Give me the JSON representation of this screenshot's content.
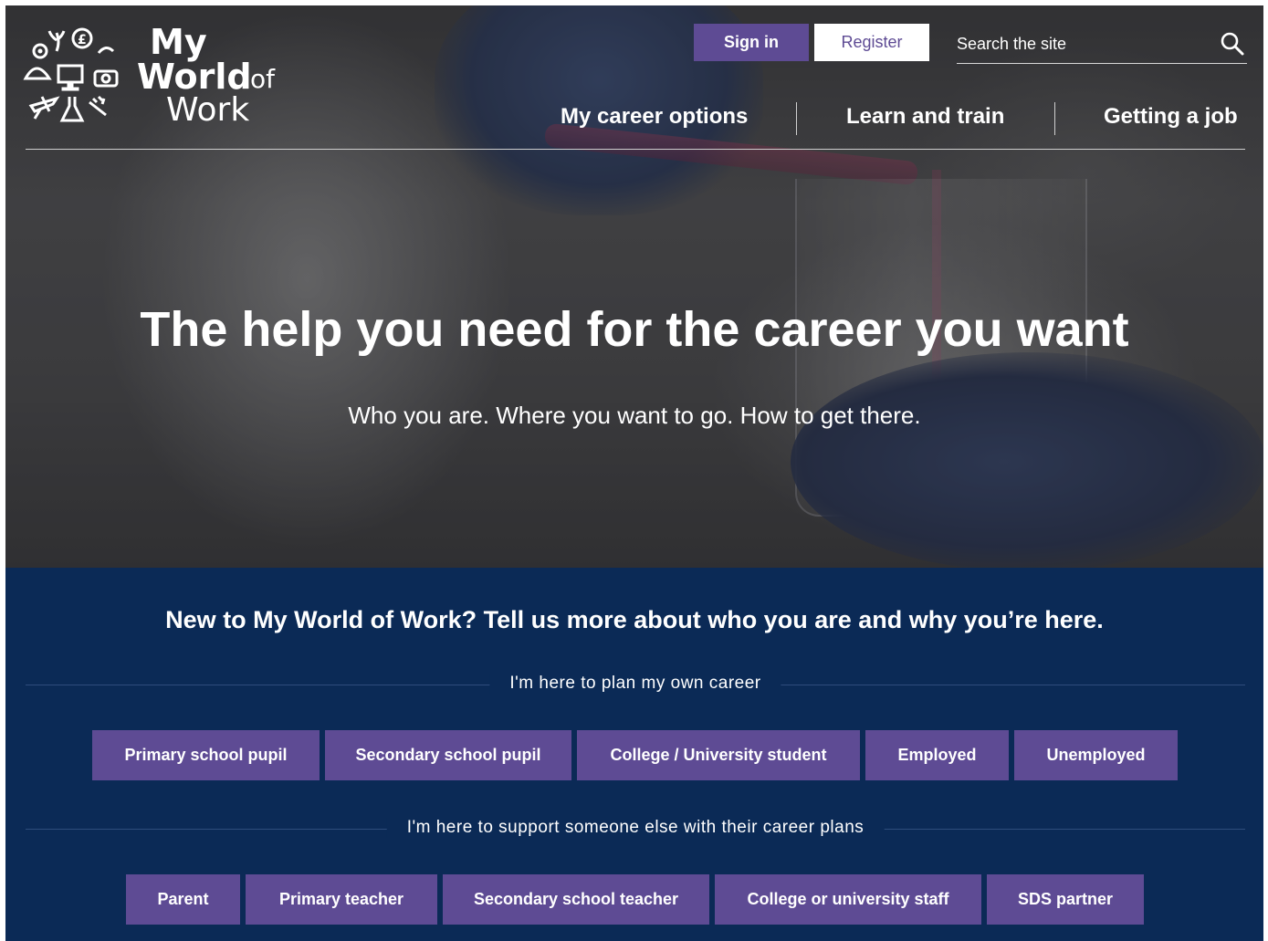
{
  "header": {
    "logo": {
      "line1": "My",
      "line2": "World",
      "line2_suffix": "of",
      "line3": "Work"
    },
    "sign_in_label": "Sign in",
    "register_label": "Register",
    "search": {
      "placeholder": "Search the site",
      "value": "",
      "icon": "search-icon"
    },
    "nav": [
      {
        "label": "My career options"
      },
      {
        "label": "Learn and train"
      },
      {
        "label": "Getting a job"
      }
    ]
  },
  "hero": {
    "title": "The help you need for the career you want",
    "subtitle": "Who you are. Where you want to go. How to get there."
  },
  "panel": {
    "heading": "New to My World of Work? Tell us more about who you are and why you’re here.",
    "own_career": {
      "label": "I'm here to plan my own career",
      "options": [
        "Primary school pupil",
        "Secondary school pupil",
        "College / University student",
        "Employed",
        "Unemployed"
      ]
    },
    "support": {
      "label": "I'm here to support someone else with their career plans",
      "options": [
        "Parent",
        "Primary teacher",
        "Secondary school teacher",
        "College or university staff",
        "SDS partner"
      ]
    }
  },
  "colors": {
    "accent_purple": "#5e4b94",
    "panel_navy": "#0b2a56",
    "text_white": "#ffffff"
  }
}
